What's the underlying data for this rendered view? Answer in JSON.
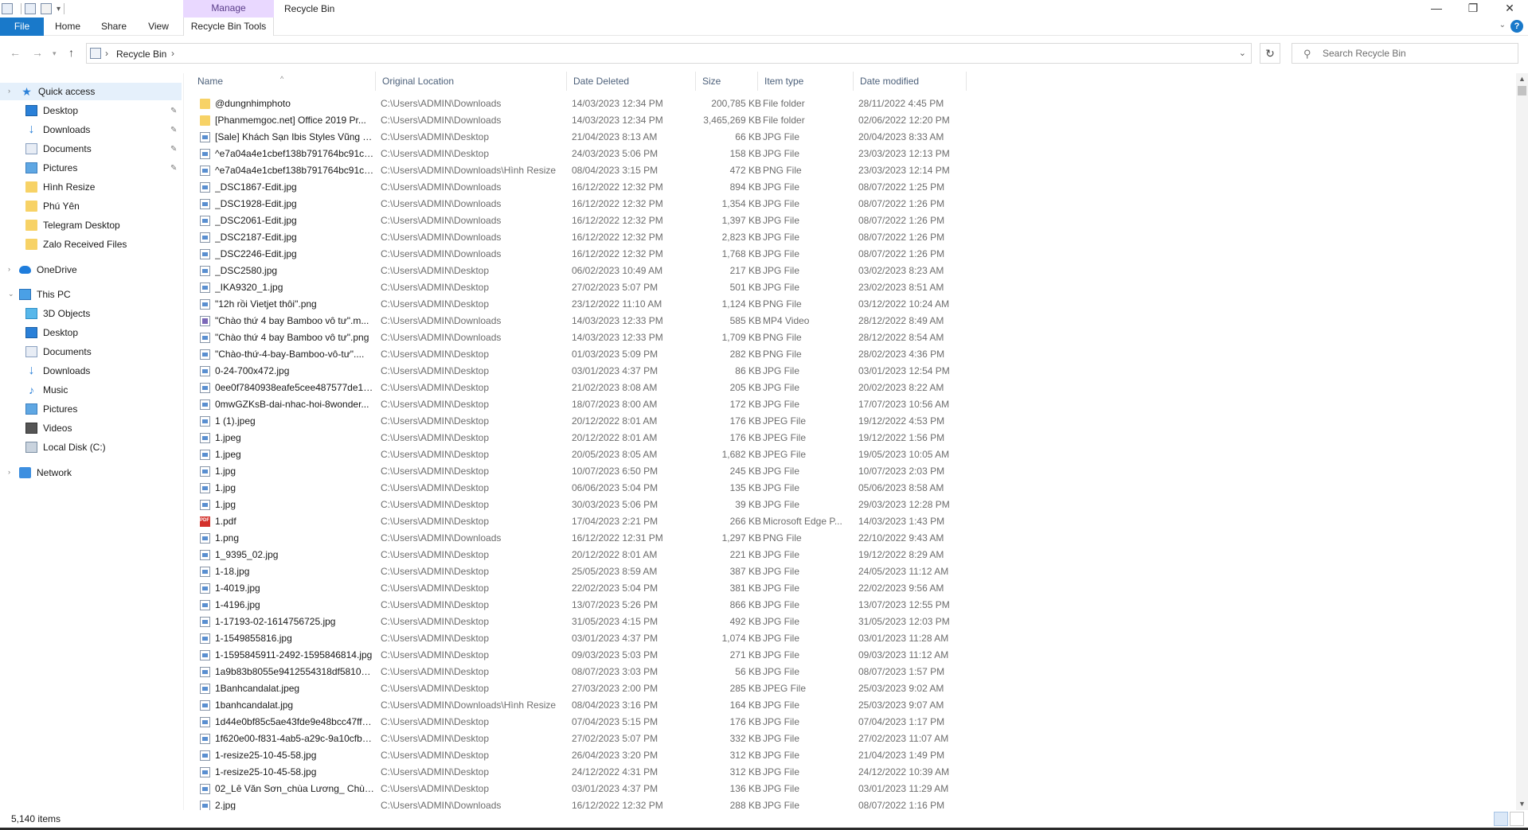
{
  "window": {
    "title": "Recycle Bin",
    "manage_tab": "Manage"
  },
  "ribbon": {
    "tabs": [
      "File",
      "Home",
      "Share",
      "View",
      "Recycle Bin Tools"
    ]
  },
  "address": {
    "path": "Recycle Bin",
    "refresh_icon": "refresh-icon"
  },
  "search": {
    "placeholder": "Search Recycle Bin"
  },
  "nav": {
    "quick_access": "Quick access",
    "quick_items": [
      "Desktop",
      "Downloads",
      "Documents",
      "Pictures",
      "Hình Resize",
      "Phú Yên",
      "Telegram Desktop",
      "Zalo Received Files"
    ],
    "onedrive": "OneDrive",
    "this_pc": "This PC",
    "pc_items": [
      "3D Objects",
      "Desktop",
      "Documents",
      "Downloads",
      "Music",
      "Pictures",
      "Videos",
      "Local Disk (C:)"
    ],
    "network": "Network"
  },
  "columns": [
    "Name",
    "Original Location",
    "Date Deleted",
    "Size",
    "Item type",
    "Date modified"
  ],
  "files": [
    {
      "name": "@dungnhimphoto",
      "loc": "C:\\Users\\ADMIN\\Downloads",
      "deleted": "14/03/2023 12:34 PM",
      "size": "200,785 KB",
      "type": "File folder",
      "modified": "28/11/2022 4:45 PM",
      "icon": "folder"
    },
    {
      "name": "[Phanmemgoc.net] Office 2019 Pr...",
      "loc": "C:\\Users\\ADMIN\\Downloads",
      "deleted": "14/03/2023 12:34 PM",
      "size": "3,465,269 KB",
      "type": "File folder",
      "modified": "02/06/2022 12:20 PM",
      "icon": "folder"
    },
    {
      "name": "[Sale] Khách Sạn Ibis Styles Vũng T...",
      "loc": "C:\\Users\\ADMIN\\Desktop",
      "deleted": "21/04/2023 8:13 AM",
      "size": "66 KB",
      "type": "JPG File",
      "modified": "20/04/2023 8:33 AM",
      "icon": "img"
    },
    {
      "name": "^e7a04a4e1cbef138b791764bc91cc...",
      "loc": "C:\\Users\\ADMIN\\Desktop",
      "deleted": "24/03/2023 5:06 PM",
      "size": "158 KB",
      "type": "JPG File",
      "modified": "23/03/2023 12:13 PM",
      "icon": "img"
    },
    {
      "name": "^e7a04a4e1cbef138b791764bc91cc...",
      "loc": "C:\\Users\\ADMIN\\Downloads\\Hình Resize",
      "deleted": "08/04/2023 3:15 PM",
      "size": "472 KB",
      "type": "PNG File",
      "modified": "23/03/2023 12:14 PM",
      "icon": "img"
    },
    {
      "name": "_DSC1867-Edit.jpg",
      "loc": "C:\\Users\\ADMIN\\Downloads",
      "deleted": "16/12/2022 12:32 PM",
      "size": "894 KB",
      "type": "JPG File",
      "modified": "08/07/2022 1:25 PM",
      "icon": "img"
    },
    {
      "name": "_DSC1928-Edit.jpg",
      "loc": "C:\\Users\\ADMIN\\Downloads",
      "deleted": "16/12/2022 12:32 PM",
      "size": "1,354 KB",
      "type": "JPG File",
      "modified": "08/07/2022 1:26 PM",
      "icon": "img"
    },
    {
      "name": "_DSC2061-Edit.jpg",
      "loc": "C:\\Users\\ADMIN\\Downloads",
      "deleted": "16/12/2022 12:32 PM",
      "size": "1,397 KB",
      "type": "JPG File",
      "modified": "08/07/2022 1:26 PM",
      "icon": "img"
    },
    {
      "name": "_DSC2187-Edit.jpg",
      "loc": "C:\\Users\\ADMIN\\Downloads",
      "deleted": "16/12/2022 12:32 PM",
      "size": "2,823 KB",
      "type": "JPG File",
      "modified": "08/07/2022 1:26 PM",
      "icon": "img"
    },
    {
      "name": "_DSC2246-Edit.jpg",
      "loc": "C:\\Users\\ADMIN\\Downloads",
      "deleted": "16/12/2022 12:32 PM",
      "size": "1,768 KB",
      "type": "JPG File",
      "modified": "08/07/2022 1:26 PM",
      "icon": "img"
    },
    {
      "name": "_DSC2580.jpg",
      "loc": "C:\\Users\\ADMIN\\Desktop",
      "deleted": "06/02/2023 10:49 AM",
      "size": "217 KB",
      "type": "JPG File",
      "modified": "03/02/2023 8:23 AM",
      "icon": "img"
    },
    {
      "name": "_IKA9320_1.jpg",
      "loc": "C:\\Users\\ADMIN\\Desktop",
      "deleted": "27/02/2023 5:07 PM",
      "size": "501 KB",
      "type": "JPG File",
      "modified": "23/02/2023 8:51 AM",
      "icon": "img"
    },
    {
      "name": "\"12h rồi Vietjet thôi\".png",
      "loc": "C:\\Users\\ADMIN\\Desktop",
      "deleted": "23/12/2022 11:10 AM",
      "size": "1,124 KB",
      "type": "PNG File",
      "modified": "03/12/2022 10:24 AM",
      "icon": "img"
    },
    {
      "name": "\"Chào thứ 4 bay Bamboo vô tư\".m...",
      "loc": "C:\\Users\\ADMIN\\Downloads",
      "deleted": "14/03/2023 12:33 PM",
      "size": "585 KB",
      "type": "MP4 Video",
      "modified": "28/12/2022 8:49 AM",
      "icon": "video"
    },
    {
      "name": "\"Chào thứ 4 bay Bamboo vô tư\".png",
      "loc": "C:\\Users\\ADMIN\\Downloads",
      "deleted": "14/03/2023 12:33 PM",
      "size": "1,709 KB",
      "type": "PNG File",
      "modified": "28/12/2022 8:54 AM",
      "icon": "img"
    },
    {
      "name": "\"Chào-thứ-4-bay-Bamboo-vô-tư\"....",
      "loc": "C:\\Users\\ADMIN\\Desktop",
      "deleted": "01/03/2023 5:09 PM",
      "size": "282 KB",
      "type": "PNG File",
      "modified": "28/02/2023 4:36 PM",
      "icon": "img"
    },
    {
      "name": "0-24-700x472.jpg",
      "loc": "C:\\Users\\ADMIN\\Desktop",
      "deleted": "03/01/2023 4:37 PM",
      "size": "86 KB",
      "type": "JPG File",
      "modified": "03/01/2023 12:54 PM",
      "icon": "img"
    },
    {
      "name": "0ee0f7840938eafe5cee487577de166...",
      "loc": "C:\\Users\\ADMIN\\Desktop",
      "deleted": "21/02/2023 8:08 AM",
      "size": "205 KB",
      "type": "JPG File",
      "modified": "20/02/2023 8:22 AM",
      "icon": "img"
    },
    {
      "name": "0mwGZKsB-dai-nhac-hoi-8wonder...",
      "loc": "C:\\Users\\ADMIN\\Desktop",
      "deleted": "18/07/2023 8:00 AM",
      "size": "172 KB",
      "type": "JPG File",
      "modified": "17/07/2023 10:56 AM",
      "icon": "img"
    },
    {
      "name": "1 (1).jpeg",
      "loc": "C:\\Users\\ADMIN\\Desktop",
      "deleted": "20/12/2022 8:01 AM",
      "size": "176 KB",
      "type": "JPEG File",
      "modified": "19/12/2022 4:53 PM",
      "icon": "img"
    },
    {
      "name": "1.jpeg",
      "loc": "C:\\Users\\ADMIN\\Desktop",
      "deleted": "20/12/2022 8:01 AM",
      "size": "176 KB",
      "type": "JPEG File",
      "modified": "19/12/2022 1:56 PM",
      "icon": "img"
    },
    {
      "name": "1.jpeg",
      "loc": "C:\\Users\\ADMIN\\Desktop",
      "deleted": "20/05/2023 8:05 AM",
      "size": "1,682 KB",
      "type": "JPEG File",
      "modified": "19/05/2023 10:05 AM",
      "icon": "img"
    },
    {
      "name": "1.jpg",
      "loc": "C:\\Users\\ADMIN\\Desktop",
      "deleted": "10/07/2023 6:50 PM",
      "size": "245 KB",
      "type": "JPG File",
      "modified": "10/07/2023 2:03 PM",
      "icon": "img"
    },
    {
      "name": "1.jpg",
      "loc": "C:\\Users\\ADMIN\\Desktop",
      "deleted": "06/06/2023 5:04 PM",
      "size": "135 KB",
      "type": "JPG File",
      "modified": "05/06/2023 8:58 AM",
      "icon": "img"
    },
    {
      "name": "1.jpg",
      "loc": "C:\\Users\\ADMIN\\Desktop",
      "deleted": "30/03/2023 5:06 PM",
      "size": "39 KB",
      "type": "JPG File",
      "modified": "29/03/2023 12:28 PM",
      "icon": "img"
    },
    {
      "name": "1.pdf",
      "loc": "C:\\Users\\ADMIN\\Desktop",
      "deleted": "17/04/2023 2:21 PM",
      "size": "266 KB",
      "type": "Microsoft Edge P...",
      "modified": "14/03/2023 1:43 PM",
      "icon": "pdf"
    },
    {
      "name": "1.png",
      "loc": "C:\\Users\\ADMIN\\Downloads",
      "deleted": "16/12/2022 12:31 PM",
      "size": "1,297 KB",
      "type": "PNG File",
      "modified": "22/10/2022 9:43 AM",
      "icon": "img"
    },
    {
      "name": "1_9395_02.jpg",
      "loc": "C:\\Users\\ADMIN\\Desktop",
      "deleted": "20/12/2022 8:01 AM",
      "size": "221 KB",
      "type": "JPG File",
      "modified": "19/12/2022 8:29 AM",
      "icon": "img"
    },
    {
      "name": "1-18.jpg",
      "loc": "C:\\Users\\ADMIN\\Desktop",
      "deleted": "25/05/2023 8:59 AM",
      "size": "387 KB",
      "type": "JPG File",
      "modified": "24/05/2023 11:12 AM",
      "icon": "img"
    },
    {
      "name": "1-4019.jpg",
      "loc": "C:\\Users\\ADMIN\\Desktop",
      "deleted": "22/02/2023 5:04 PM",
      "size": "381 KB",
      "type": "JPG File",
      "modified": "22/02/2023 9:56 AM",
      "icon": "img"
    },
    {
      "name": "1-4196.jpg",
      "loc": "C:\\Users\\ADMIN\\Desktop",
      "deleted": "13/07/2023 5:26 PM",
      "size": "866 KB",
      "type": "JPG File",
      "modified": "13/07/2023 12:55 PM",
      "icon": "img"
    },
    {
      "name": "1-17193-02-1614756725.jpg",
      "loc": "C:\\Users\\ADMIN\\Desktop",
      "deleted": "31/05/2023 4:15 PM",
      "size": "492 KB",
      "type": "JPG File",
      "modified": "31/05/2023 12:03 PM",
      "icon": "img"
    },
    {
      "name": "1-1549855816.jpg",
      "loc": "C:\\Users\\ADMIN\\Desktop",
      "deleted": "03/01/2023 4:37 PM",
      "size": "1,074 KB",
      "type": "JPG File",
      "modified": "03/01/2023 11:28 AM",
      "icon": "img"
    },
    {
      "name": "1-1595845911-2492-1595846814.jpg",
      "loc": "C:\\Users\\ADMIN\\Desktop",
      "deleted": "09/03/2023 5:03 PM",
      "size": "271 KB",
      "type": "JPG File",
      "modified": "09/03/2023 11:12 AM",
      "icon": "img"
    },
    {
      "name": "1a9b83b8055e9412554318df5810d9...",
      "loc": "C:\\Users\\ADMIN\\Desktop",
      "deleted": "08/07/2023 3:03 PM",
      "size": "56 KB",
      "type": "JPG File",
      "modified": "08/07/2023 1:57 PM",
      "icon": "img"
    },
    {
      "name": "1Banhcandalat.jpeg",
      "loc": "C:\\Users\\ADMIN\\Desktop",
      "deleted": "27/03/2023 2:00 PM",
      "size": "285 KB",
      "type": "JPEG File",
      "modified": "25/03/2023 9:02 AM",
      "icon": "img"
    },
    {
      "name": "1banhcandalat.jpg",
      "loc": "C:\\Users\\ADMIN\\Downloads\\Hình Resize",
      "deleted": "08/04/2023 3:16 PM",
      "size": "164 KB",
      "type": "JPG File",
      "modified": "25/03/2023 9:07 AM",
      "icon": "img"
    },
    {
      "name": "1d44e0bf85c5ae43fde9e48bcc47ff7...",
      "loc": "C:\\Users\\ADMIN\\Desktop",
      "deleted": "07/04/2023 5:15 PM",
      "size": "176 KB",
      "type": "JPG File",
      "modified": "07/04/2023 1:17 PM",
      "icon": "img"
    },
    {
      "name": "1f620e00-f831-4ab5-a29c-9a10cfbc...",
      "loc": "C:\\Users\\ADMIN\\Desktop",
      "deleted": "27/02/2023 5:07 PM",
      "size": "332 KB",
      "type": "JPG File",
      "modified": "27/02/2023 11:07 AM",
      "icon": "img"
    },
    {
      "name": "1-resize25-10-45-58.jpg",
      "loc": "C:\\Users\\ADMIN\\Desktop",
      "deleted": "26/04/2023 3:20 PM",
      "size": "312 KB",
      "type": "JPG File",
      "modified": "21/04/2023 1:49 PM",
      "icon": "img"
    },
    {
      "name": "1-resize25-10-45-58.jpg",
      "loc": "C:\\Users\\ADMIN\\Desktop",
      "deleted": "24/12/2022 4:31 PM",
      "size": "312 KB",
      "type": "JPG File",
      "modified": "24/12/2022 10:39 AM",
      "icon": "img"
    },
    {
      "name": "02_Lê Văn Sơn_chùa Lương_ Chùa ...",
      "loc": "C:\\Users\\ADMIN\\Desktop",
      "deleted": "03/01/2023 4:37 PM",
      "size": "136 KB",
      "type": "JPG File",
      "modified": "03/01/2023 11:29 AM",
      "icon": "img"
    },
    {
      "name": "2.jpg",
      "loc": "C:\\Users\\ADMIN\\Downloads",
      "deleted": "16/12/2022 12:32 PM",
      "size": "288 KB",
      "type": "JPG File",
      "modified": "08/07/2022 1:16 PM",
      "icon": "img"
    }
  ],
  "status": {
    "item_count": "5,140 items"
  }
}
